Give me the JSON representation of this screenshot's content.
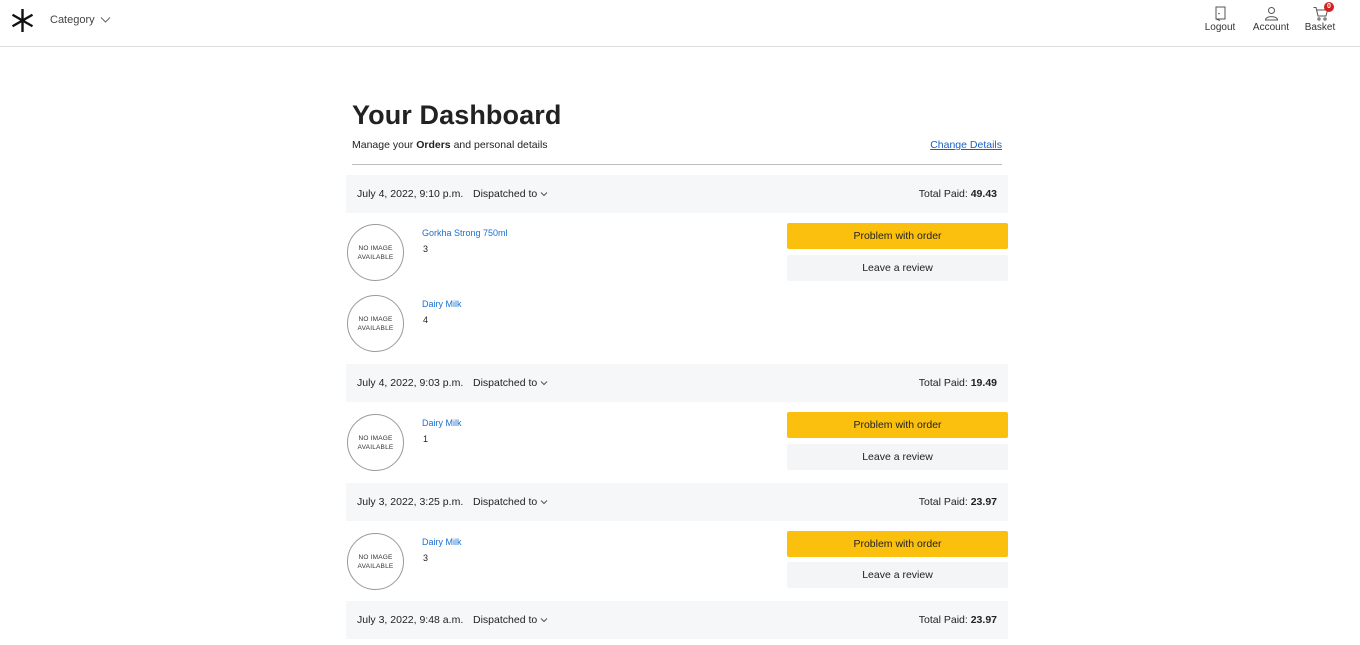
{
  "header": {
    "logo": "asterisk-logo",
    "category_label": "Category",
    "nav": [
      {
        "label": "Logout",
        "icon": "logout-door-icon"
      },
      {
        "label": "Account",
        "icon": "user-icon"
      },
      {
        "label": "Basket",
        "icon": "cart-icon",
        "badge": "0"
      }
    ]
  },
  "dashboard": {
    "title": "Your Dashboard",
    "subtitle_prefix": "Manage your ",
    "subtitle_bold": "Orders",
    "subtitle_suffix": " and personal details",
    "change_details": "Change Details"
  },
  "orders": [
    {
      "date": "July 4, 2022, 9:10 p.m.",
      "dispatched_label": "Dispatched to",
      "total_label": "Total Paid: ",
      "total": "49.43",
      "items": [
        {
          "image_text_1": "NO IMAGE",
          "image_text_2": "AVAILABLE",
          "name": "Gorkha Strong 750ml",
          "qty": "3"
        },
        {
          "image_text_1": "NO IMAGE",
          "image_text_2": "AVAILABLE",
          "name": "Dairy Milk",
          "qty": "4"
        }
      ],
      "problem_label": "Problem with order",
      "review_label": "Leave a review"
    },
    {
      "date": "July 4, 2022, 9:03 p.m.",
      "dispatched_label": "Dispatched to",
      "total_label": "Total Paid: ",
      "total": "19.49",
      "items": [
        {
          "image_text_1": "NO IMAGE",
          "image_text_2": "AVAILABLE",
          "name": "Dairy Milk",
          "qty": "1"
        }
      ],
      "problem_label": "Problem with order",
      "review_label": "Leave a review"
    },
    {
      "date": "July 3, 2022, 3:25 p.m.",
      "dispatched_label": "Dispatched to",
      "total_label": "Total Paid: ",
      "total": "23.97",
      "items": [
        {
          "image_text_1": "NO IMAGE",
          "image_text_2": "AVAILABLE",
          "name": "Dairy Milk",
          "qty": "3"
        }
      ],
      "problem_label": "Problem with order",
      "review_label": "Leave a review"
    },
    {
      "date": "July 3, 2022, 9:48 a.m.",
      "dispatched_label": "Dispatched to",
      "total_label": "Total Paid: ",
      "total": "23.97"
    }
  ],
  "colors": {
    "accent_yellow": "#fbc00d",
    "link_blue": "#1a6fd0",
    "badge_red": "#d32020",
    "row_bg": "#f6f7f8"
  }
}
